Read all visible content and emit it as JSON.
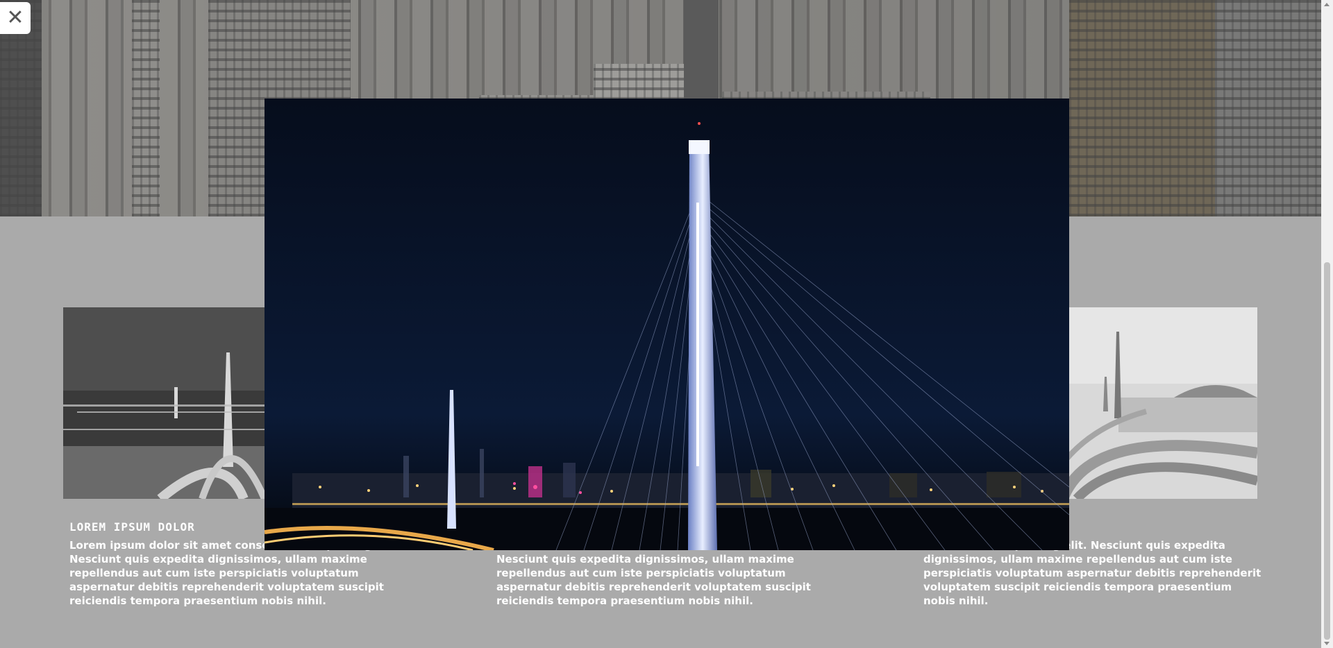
{
  "lightbox": {
    "close_label": "✕",
    "image_alt": "Cable-stayed bridge tower illuminated at night with city skyline"
  },
  "cards": [
    {
      "title": "LOREM IPSUM DOLOR",
      "text": "Lorem ipsum dolor sit amet consectetur adipisicing elit. Nesciunt quis expedita dignissimos, ullam maxime repellendus aut cum iste perspiciatis voluptatum aspernatur debitis reprehenderit voluptatem suscipit reiciendis tempora praesentium nobis nihil."
    },
    {
      "title": "",
      "text": "Nesciunt quis expedita dignissimos, ullam maxime repellendus aut cum iste perspiciatis voluptatum aspernatur debitis reprehenderit voluptatem suscipit reiciendis tempora praesentium nobis nihil."
    },
    {
      "title": "",
      "text": "consectetur adipisicing elit. Nesciunt quis expedita dignissimos, ullam maxime repellendus aut cum iste perspiciatis voluptatum aspernatur debitis reprehenderit voluptatem suscipit reiciendis tempora praesentium nobis nihil."
    }
  ],
  "colors": {
    "page_background": "#aaaaaa",
    "text": "#ffffff",
    "night_sky": "#07101f",
    "bridge_light": "#b9c8ff"
  }
}
